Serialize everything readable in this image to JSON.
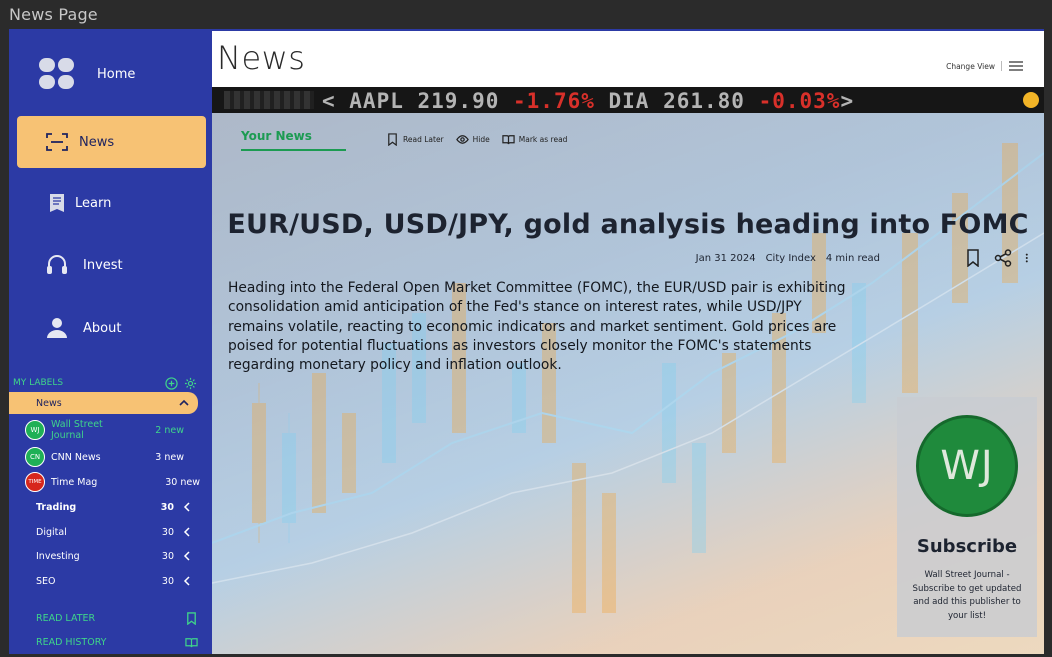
{
  "window": {
    "title": "News Page"
  },
  "sidebar": {
    "nav": [
      {
        "label": "Home",
        "icon": "grid-icon"
      },
      {
        "label": "News",
        "icon": "news-scan-icon",
        "active": true
      },
      {
        "label": "Learn",
        "icon": "book-icon"
      },
      {
        "label": "Invest",
        "icon": "headset-icon"
      },
      {
        "label": "About",
        "icon": "user-icon"
      }
    ],
    "labels_header": "MY LABELS",
    "open_group": "News",
    "publishers": [
      {
        "badge": "WJ",
        "name": "Wall Street Journal",
        "count": "2 new",
        "color": "#1fb056"
      },
      {
        "badge": "CN",
        "name": "CNN News",
        "count": "3 new",
        "color": "#1fb056"
      },
      {
        "badge": "TIME",
        "name": "Time Mag",
        "count": "30 new",
        "color": "#d7261c"
      }
    ],
    "groups": [
      {
        "label": "Trading",
        "count": "30"
      },
      {
        "label": "Digital",
        "count": "30"
      },
      {
        "label": "Investing",
        "count": "30"
      },
      {
        "label": "SEO",
        "count": "30"
      }
    ],
    "footer": {
      "read_later": "READ LATER",
      "read_history": "READ HISTORY"
    }
  },
  "header": {
    "title": "News",
    "change_view": "Change View"
  },
  "ticker": {
    "text": "< AAPL 219.90 -1.76% DIA 261.80 -0.03% >"
  },
  "tabs": {
    "active": "Your News",
    "actions": [
      "Read Later",
      "Hide",
      "Mark as read"
    ]
  },
  "article": {
    "headline": "EUR/USD, USD/JPY, gold analysis heading into FOMC",
    "date": "Jan 31 2024",
    "source": "City Index",
    "read_time": "4 min read",
    "body": "Heading into the Federal Open Market Committee (FOMC), the EUR/USD pair is exhibiting consolidation amid anticipation of the Fed's stance on interest rates, while USD/JPY remains volatile, reacting to economic indicators and market sentiment. Gold prices are poised for potential fluctuations as investors closely monitor the FOMC's statements regarding monetary policy and inflation outlook."
  },
  "subscribe": {
    "badge": "WJ",
    "title": "Subscribe",
    "description": "Wall Street Journal - Subscribe to get updated and add this publisher to your list!"
  },
  "colors": {
    "sidebar": "#2c3aa5",
    "accent": "#f7c274",
    "green": "#1c9b52"
  }
}
